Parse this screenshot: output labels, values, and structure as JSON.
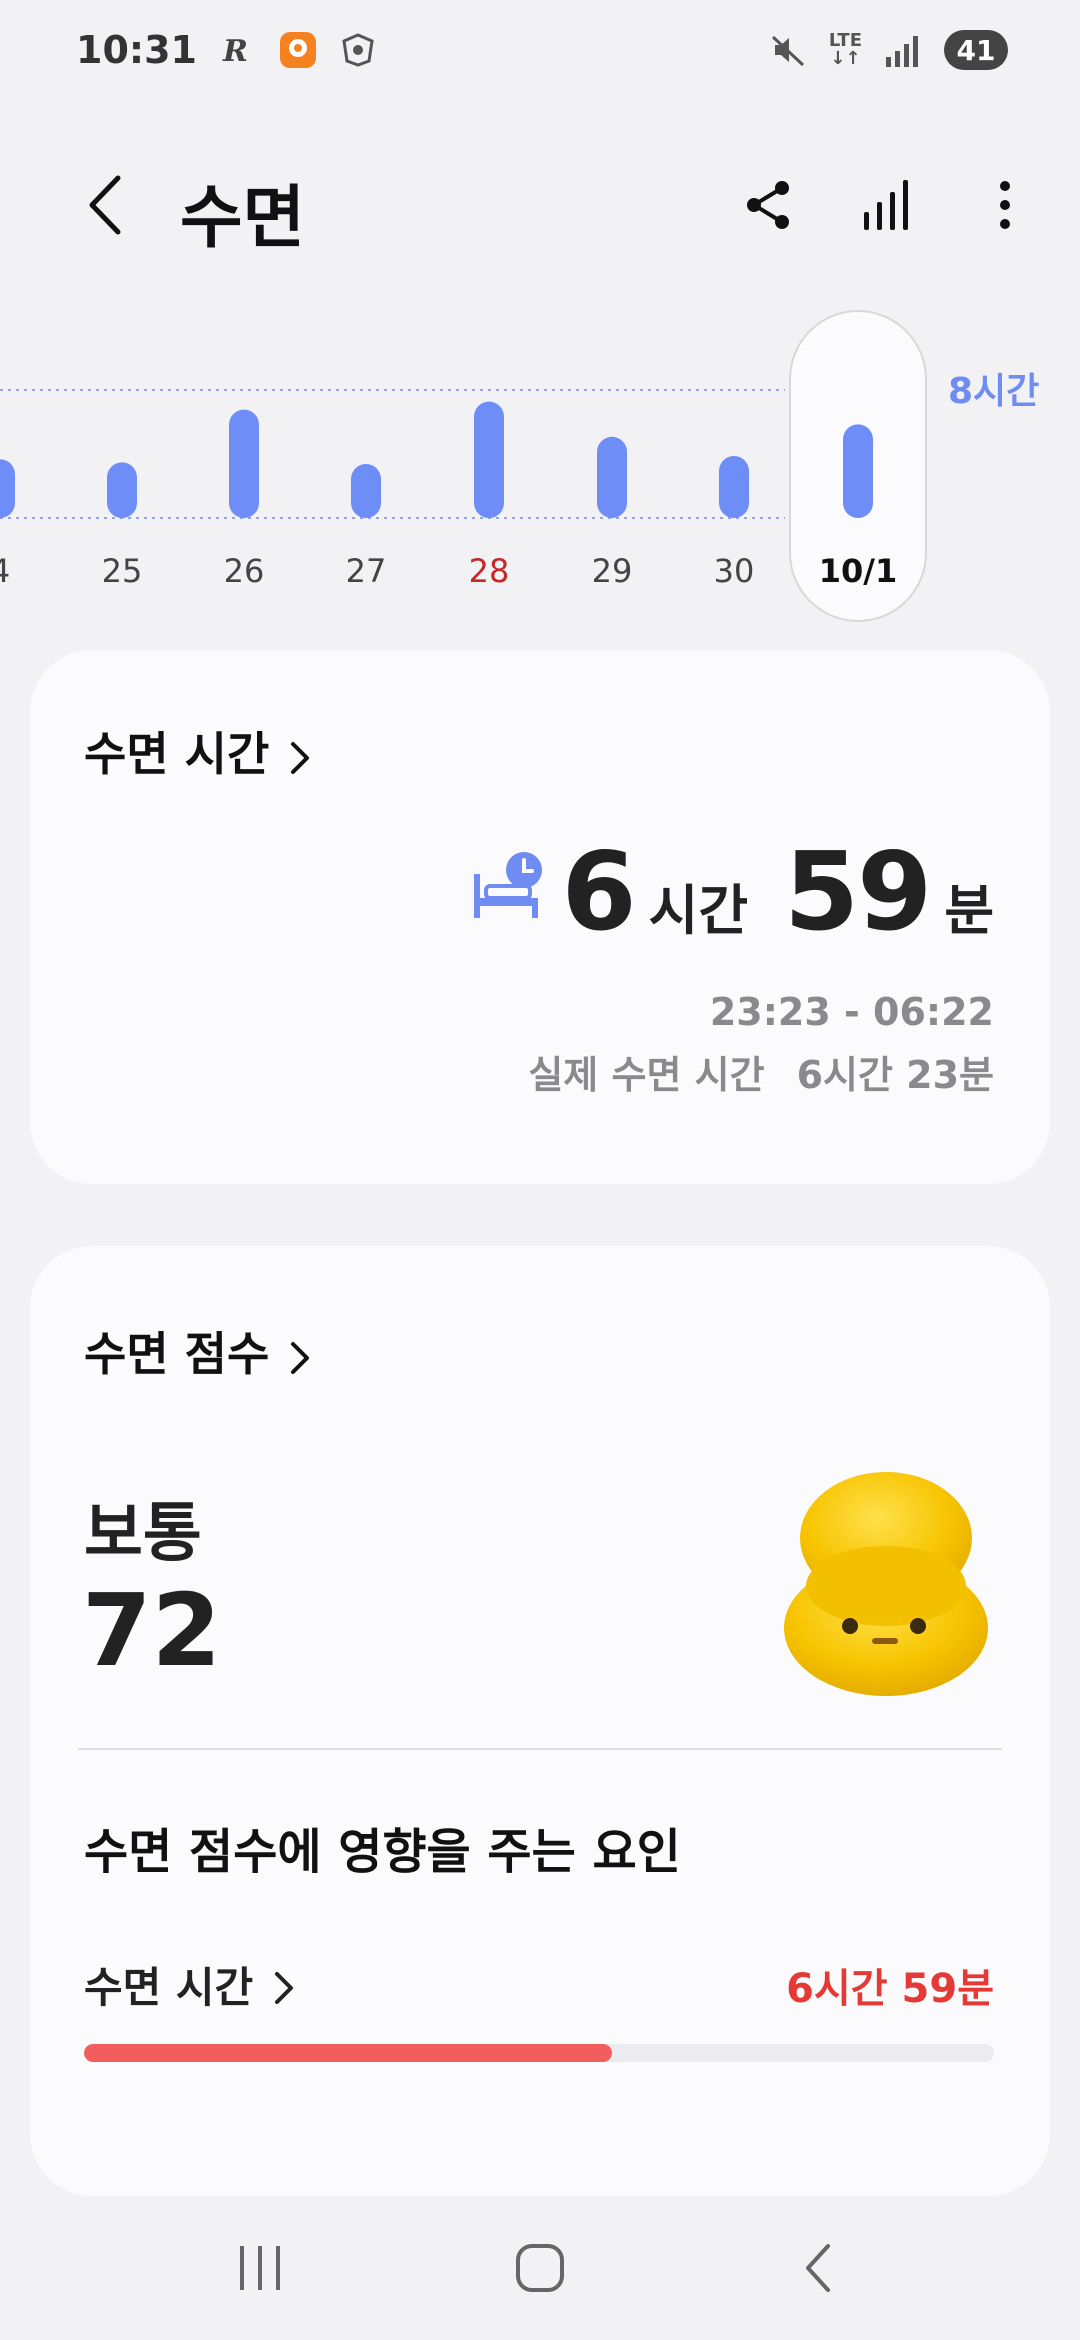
{
  "status_bar": {
    "time": "10:31",
    "network": "LTE",
    "battery": "41",
    "icons": [
      "r-notification-icon",
      "app-notification-icon",
      "emblem-notification-icon",
      "mute-icon",
      "signal-icon"
    ]
  },
  "header": {
    "title": "수면",
    "icons": [
      "back-icon",
      "share-icon",
      "stats-icon",
      "more-icon"
    ]
  },
  "chart": {
    "goal_label": "8시간",
    "goal_hours": 8,
    "days": [
      {
        "label": "4",
        "hours": 4.8,
        "highlight": false,
        "selected": false
      },
      {
        "label": "25",
        "hours": 4.6,
        "highlight": false,
        "selected": false
      },
      {
        "label": "26",
        "hours": 7.9,
        "highlight": false,
        "selected": false
      },
      {
        "label": "27",
        "hours": 4.5,
        "highlight": false,
        "selected": false
      },
      {
        "label": "28",
        "hours": 8.4,
        "highlight": true,
        "selected": false
      },
      {
        "label": "29",
        "hours": 6.2,
        "highlight": false,
        "selected": false
      },
      {
        "label": "30",
        "hours": 5.0,
        "highlight": false,
        "selected": false
      },
      {
        "label": "10/1",
        "hours": 6.98,
        "highlight": false,
        "selected": true
      }
    ]
  },
  "sleep_time_card": {
    "title": "수면 시간",
    "hours": "6",
    "hours_unit": "시간",
    "minutes": "59",
    "minutes_unit": "분",
    "range": "23:23 - 06:22",
    "actual_label": "실제 수면 시간",
    "actual_value": "6시간 23분"
  },
  "score_card": {
    "title": "수면 점수",
    "rating": "보통",
    "score": "72",
    "factors_title": "수면 점수에 영향을 주는 요인",
    "factors": [
      {
        "name": "수면 시간",
        "value": "6시간 59분",
        "progress": 0.58,
        "color": "#e53935"
      }
    ]
  },
  "nav": {
    "icons": [
      "recents-icon",
      "home-icon",
      "back-nav-icon"
    ]
  },
  "colors": {
    "accent": "#6e8cf2",
    "bar": "#6f8df7",
    "warning": "#e53935",
    "progress_fill": "#f25d5d"
  }
}
